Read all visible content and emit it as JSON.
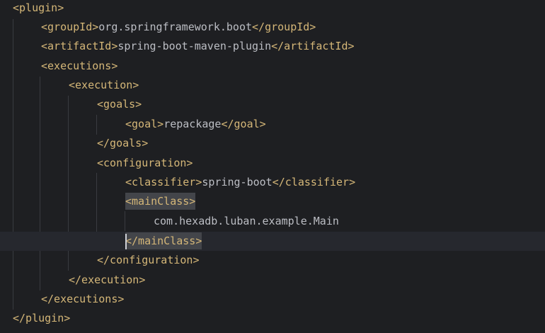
{
  "colors": {
    "background": "#1e1f22",
    "tag": "#d5b778",
    "text": "#bcbec4",
    "current_line": "#26282e",
    "match_highlight": "#43454a",
    "indent_guide": "#393b40"
  },
  "lines": [
    {
      "open": "<plugin>",
      "text": "",
      "close": ""
    },
    {
      "open": "<groupId>",
      "text": "org.springframework.boot",
      "close": "</groupId>"
    },
    {
      "open": "<artifactId>",
      "text": "spring-boot-maven-plugin",
      "close": "</artifactId>"
    },
    {
      "open": "<executions>",
      "text": "",
      "close": ""
    },
    {
      "open": "<execution>",
      "text": "",
      "close": ""
    },
    {
      "open": "<goals>",
      "text": "",
      "close": ""
    },
    {
      "open": "<goal>",
      "text": "repackage",
      "close": "</goal>"
    },
    {
      "open": "</goals>",
      "text": "",
      "close": ""
    },
    {
      "open": "<configuration>",
      "text": "",
      "close": ""
    },
    {
      "open": "<classifier>",
      "text": "spring-boot",
      "close": "</classifier>"
    },
    {
      "open": "<mainClass>",
      "text": "",
      "close": ""
    },
    {
      "open": "",
      "text": "com.hexadb.luban.example.Main",
      "close": ""
    },
    {
      "open": "</mainClass>",
      "text": "",
      "close": ""
    },
    {
      "open": "</configuration>",
      "text": "",
      "close": ""
    },
    {
      "open": "</execution>",
      "text": "",
      "close": ""
    },
    {
      "open": "</executions>",
      "text": "",
      "close": ""
    },
    {
      "open": "</plugin>",
      "text": "",
      "close": ""
    }
  ]
}
